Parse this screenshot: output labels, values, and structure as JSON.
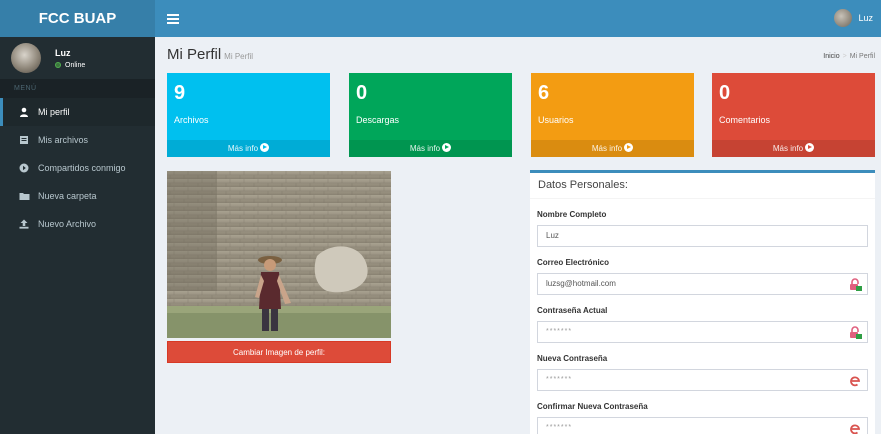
{
  "header": {
    "brand": "FCC BUAP",
    "user_name": "Luz"
  },
  "sidebar": {
    "user_name": "Luz",
    "status": "Online",
    "menu_header": "MENÚ",
    "items": [
      {
        "label": "Mi perfil",
        "icon": "user-icon"
      },
      {
        "label": "Mis archivos",
        "icon": "file-icon"
      },
      {
        "label": "Compartidos conmigo",
        "icon": "share-icon"
      },
      {
        "label": "Nueva carpeta",
        "icon": "folder-icon"
      },
      {
        "label": "Nuevo Archivo",
        "icon": "upload-icon"
      }
    ]
  },
  "page": {
    "title": "Mi Perfil",
    "subtitle": "Mi Perfil"
  },
  "breadcrumb": {
    "home": "Inicio",
    "separator": ">",
    "current": "Mi Perfil"
  },
  "boxes": [
    {
      "number": "9",
      "label": "Archivos",
      "link": "Más info",
      "color": "#00c0ef"
    },
    {
      "number": "0",
      "label": "Descargas",
      "link": "Más info",
      "color": "#00a65a"
    },
    {
      "number": "6",
      "label": "Usuarios",
      "link": "Más info",
      "color": "#f39c12"
    },
    {
      "number": "0",
      "label": "Comentarios",
      "link": "Más info",
      "color": "#dd4b39"
    }
  ],
  "profile": {
    "change_button": "Cambiar Imagen de perfil:"
  },
  "form": {
    "title": "Datos Personales:",
    "fields": [
      {
        "label": "Nombre Completo",
        "value": "Luz"
      },
      {
        "label": "Correo Electrónico",
        "value": "luzsg@hotmail.com",
        "icon": "email-lock-icon"
      },
      {
        "label": "Contraseña Actual",
        "value": "*******",
        "icon": "key-lock-icon"
      },
      {
        "label": "Nueva Contraseña",
        "value": "*******",
        "icon": "red-e-icon"
      },
      {
        "label": "Confirmar Nueva Contraseña",
        "value": "*******",
        "icon": "red-e-icon"
      }
    ]
  },
  "colors": {
    "header": "#3c8dbc",
    "logo": "#367fa9",
    "sidebar": "#222d32"
  }
}
